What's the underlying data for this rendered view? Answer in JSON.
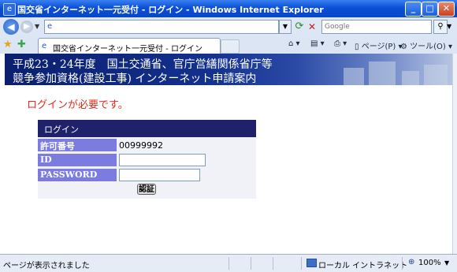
{
  "window": {
    "title": "国交省インターネット一元受付 - ログイン - Windows Internet Explorer",
    "minimize_label": "_",
    "maximize_label": "□",
    "close_label": "✕"
  },
  "addressbar": {
    "url": "",
    "search_placeholder": "Google"
  },
  "tabbar": {
    "tab_label": "国交省インターネット一元受付 - ログイン",
    "page_menu": "ページ(P)",
    "tools_menu": "ツール(O)"
  },
  "banner": {
    "line1": "平成23・24年度　国土交通省、官庁営繕関係省庁等",
    "line2": "競争参加資格(建設工事) インターネット申請案内"
  },
  "content": {
    "login_required": "ログインが必要です。"
  },
  "login_form": {
    "header": "ログイン",
    "permit_label": "許可番号",
    "permit_value": "00999992",
    "id_label": "ID",
    "password_label": "PASSWORD",
    "submit_label": "認証"
  },
  "statusbar": {
    "status_text": "ページが表示されました",
    "zone_text": "ローカル イントラネット",
    "zoom": "100%"
  },
  "icons": {
    "back": "arrow-left-icon",
    "forward": "arrow-right-icon",
    "refresh": "refresh-icon",
    "stop": "stop-icon",
    "search": "search-icon",
    "favorites": "star-icon",
    "add_favorite": "add-favorite-icon",
    "home": "home-icon",
    "feeds": "feed-icon",
    "print": "print-icon",
    "page": "page-icon",
    "tools": "gear-icon",
    "zone": "intranet-icon",
    "zoom": "zoom-icon"
  },
  "colors": {
    "titlebar": "#0a4fd6",
    "login_required": "#e02b1a",
    "login_header": "#20216b",
    "label_bg": "#7b7be0",
    "banner": "#13308e"
  }
}
